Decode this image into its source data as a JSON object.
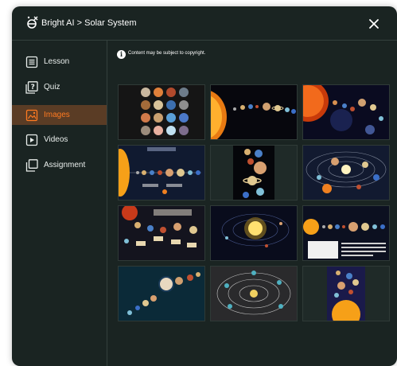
{
  "header": {
    "brand": "Bright AI",
    "breadcrumb": "> Solar System",
    "title": "Bright AI  > Solar System"
  },
  "sidebar": {
    "items": [
      {
        "label": "Lesson",
        "icon": "lesson-icon",
        "active": false
      },
      {
        "label": "Quiz",
        "icon": "quiz-icon",
        "active": false
      },
      {
        "label": "Images",
        "icon": "image-icon",
        "active": true
      },
      {
        "label": "Videos",
        "icon": "video-icon",
        "active": false
      },
      {
        "label": "Assignment",
        "icon": "assignment-icon",
        "active": false
      }
    ]
  },
  "main": {
    "notice": "Content may be subject to copyright.",
    "images": [
      {
        "alt": "planets grid"
      },
      {
        "alt": "sun and planets arc"
      },
      {
        "alt": "fiery sun with planets"
      },
      {
        "alt": "solar system diagram"
      },
      {
        "alt": "vertical planets"
      },
      {
        "alt": "orbits illustration"
      },
      {
        "alt": "labeled solar system poster"
      },
      {
        "alt": "glowing sun in space"
      },
      {
        "alt": "planets lineup with text"
      },
      {
        "alt": "diagonal planets"
      },
      {
        "alt": "orbit chart"
      },
      {
        "alt": "planets over sun"
      }
    ]
  },
  "colors": {
    "background": "#1a2422",
    "accent": "#ff7a21",
    "active_bg": "#5a3c25",
    "text": "#e9eeec"
  }
}
